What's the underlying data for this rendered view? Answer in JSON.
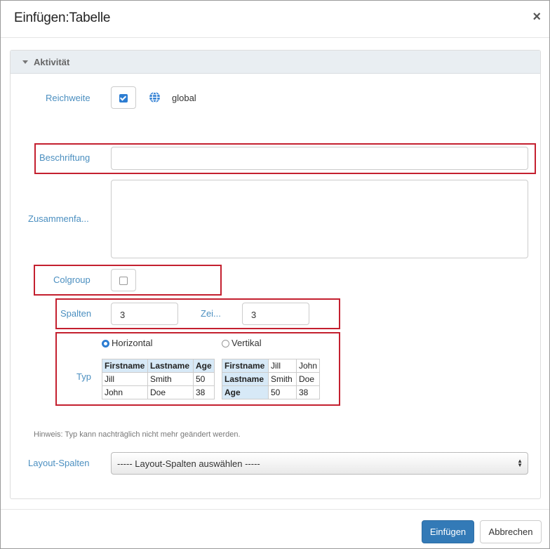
{
  "dialog": {
    "title": "Einfügen:Tabelle",
    "close": "×"
  },
  "panel": {
    "title": "Aktivität"
  },
  "form": {
    "reichweite": {
      "label": "Reichweite",
      "checked": true,
      "value": "global"
    },
    "beschriftung": {
      "label": "Beschriftung",
      "value": ""
    },
    "zusammenfassung": {
      "label": "Zusammenfa...",
      "value": ""
    },
    "colgroup": {
      "label": "Colgroup",
      "checked": false
    },
    "spalten": {
      "label": "Spalten",
      "value": "3"
    },
    "zeilen": {
      "label": "Zei...",
      "value": "3"
    },
    "typ": {
      "label": "Typ",
      "options": [
        {
          "label": "Horizontal",
          "selected": true
        },
        {
          "label": "Vertikal",
          "selected": false
        }
      ],
      "horizontal_table": [
        [
          "Firstname",
          "Lastname",
          "Age"
        ],
        [
          "Jill",
          "Smith",
          "50"
        ],
        [
          "John",
          "Doe",
          "38"
        ]
      ],
      "vertical_table": [
        [
          "Firstname",
          "Jill",
          "John"
        ],
        [
          "Lastname",
          "Smith",
          "Doe"
        ],
        [
          "Age",
          "50",
          "38"
        ]
      ]
    },
    "hint": "Hinweis: Typ kann nachträglich nicht mehr geändert werden.",
    "layout_spalten": {
      "label": "Layout-Spalten",
      "value": "----- Layout-Spalten auswählen -----"
    }
  },
  "buttons": {
    "insert": "Einfügen",
    "cancel": "Abbrechen"
  },
  "colors": {
    "accent": "#337ab7",
    "highlight_border": "#c4202f",
    "label": "#4b8fc0"
  },
  "icons": {
    "scope": "globe-icon"
  }
}
